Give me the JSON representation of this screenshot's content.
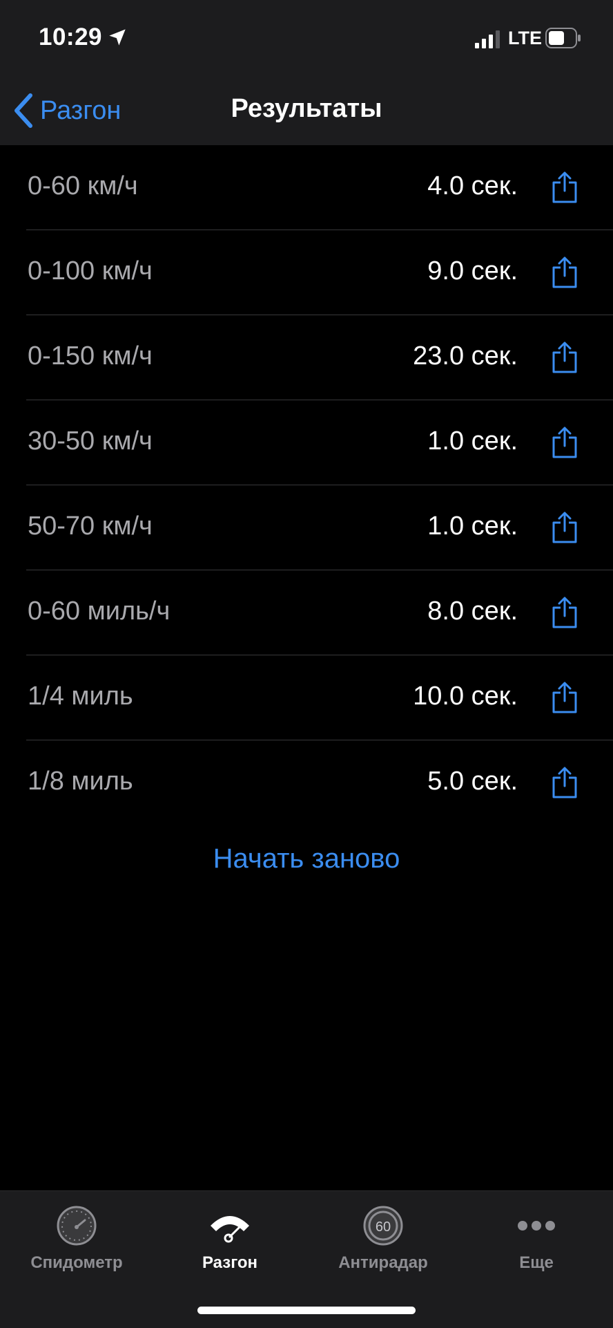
{
  "status_bar": {
    "time": "10:29",
    "network": "LTE"
  },
  "nav": {
    "back_label": "Разгон",
    "title": "Результаты"
  },
  "results": [
    {
      "label": "0-60 км/ч",
      "value": "4.0 сек."
    },
    {
      "label": "0-100 км/ч",
      "value": "9.0 сек."
    },
    {
      "label": "0-150 км/ч",
      "value": "23.0 сек."
    },
    {
      "label": "30-50 км/ч",
      "value": "1.0 сек."
    },
    {
      "label": "50-70 км/ч",
      "value": "1.0 сек."
    },
    {
      "label": "0-60 миль/ч",
      "value": "8.0 сек."
    },
    {
      "label": "1/4 миль",
      "value": "10.0 сек."
    },
    {
      "label": "1/8 миль",
      "value": "5.0 сек."
    }
  ],
  "restart_label": "Начать заново",
  "tabs": [
    {
      "label": "Спидометр",
      "icon": "speedometer-icon",
      "active": false
    },
    {
      "label": "Разгон",
      "icon": "acceleration-icon",
      "active": true
    },
    {
      "label": "Антирадар",
      "icon": "speed-limit-icon",
      "badge": "60",
      "active": false
    },
    {
      "label": "Еще",
      "icon": "more-icon",
      "active": false
    }
  ],
  "colors": {
    "accent": "#3b8df0",
    "background": "#000000",
    "bar_background": "#1c1c1e",
    "secondary_text": "#a9a9ad"
  }
}
